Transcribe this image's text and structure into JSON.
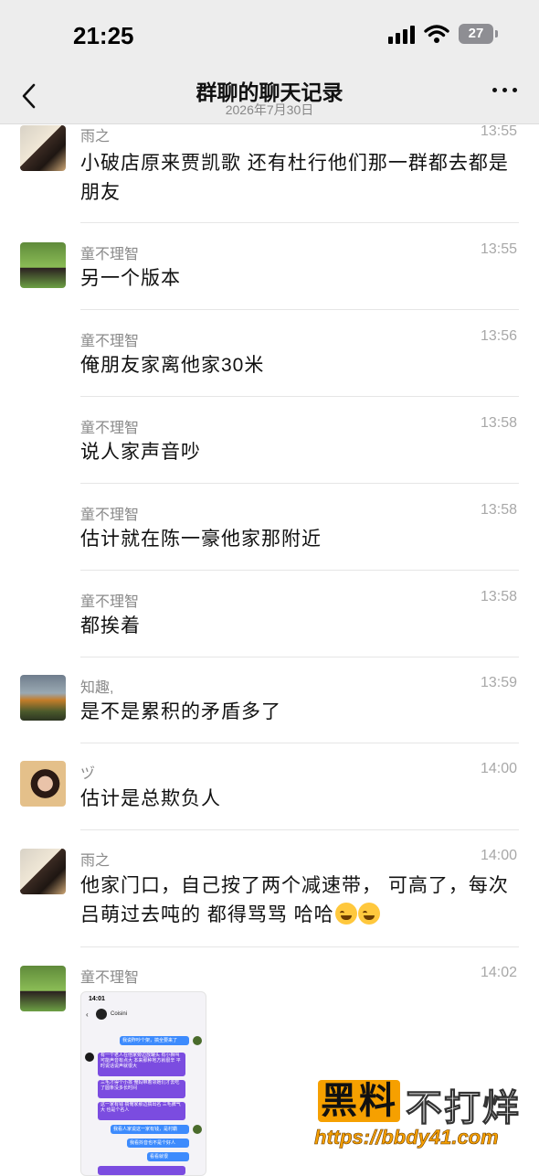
{
  "status_bar": {
    "time": "21:25",
    "battery": "27"
  },
  "header": {
    "title": "群聊的聊天记录",
    "subtitle": "2026年7月30日"
  },
  "messages": [
    {
      "sender": "雨之",
      "time": "13:55",
      "text": "小破店原来贾凯歌 还有杜行他们那一群都去都是朋友",
      "avatar": "avatar-yuzhi"
    },
    {
      "sender": "童不理智",
      "time": "13:55",
      "text": "另一个版本",
      "avatar": "avatar-tong"
    },
    {
      "sender": "童不理智",
      "time": "13:56",
      "text": "俺朋友家离他家30米"
    },
    {
      "sender": "童不理智",
      "time": "13:58",
      "text": "说人家声音吵"
    },
    {
      "sender": "童不理智",
      "time": "13:58",
      "text": "估计就在陈一豪他家那附近"
    },
    {
      "sender": "童不理智",
      "time": "13:58",
      "text": "都挨着"
    },
    {
      "sender": "知趣,",
      "time": "13:59",
      "text": "是不是累积的矛盾多了",
      "avatar": "avatar-zhiqu"
    },
    {
      "sender": "ヅ",
      "time": "14:00",
      "text": "估计是总欺负人",
      "avatar": "avatar-zu"
    },
    {
      "sender": "雨之",
      "time": "14:00",
      "text": "他家门口，自己按了两个减速带， 可高了，每次吕萌过去吨的 都得骂骂 哈哈",
      "avatar": "avatar-yuzhi"
    },
    {
      "sender": "童不理智",
      "time": "14:02",
      "avatar": "avatar-tong",
      "image": "chat-screenshot"
    }
  ],
  "screenshot_thumb": {
    "time": "14:01",
    "title": "Coisini",
    "lines": [
      "我说昨吵个架，搞全要来了",
      "有一个老人在他家旁边放罐头 有小狮叫 可能声音有点大 本来那种地方就很辛 平时说话说声就很大",
      "三毛才得个小孩 俺妈带着邻她们才去吃了圆条没多长时间",
      "这一家有钱 搞俺家那边搞出名 三毛脾气大 也是个名人",
      "我看人家说这一家有钱，是村霸",
      "我看抖音也不是个好人",
      "看看就很"
    ]
  },
  "watermark": {
    "brand1": "黑料",
    "brand2": "不打烊",
    "url": "https://bbdy41.com"
  },
  "colors": {
    "accent_purple": "#7b4ce0",
    "accent_blue": "#3d8bfd",
    "header_bg": "#ededed",
    "watermark_orange": "#f6a000"
  }
}
